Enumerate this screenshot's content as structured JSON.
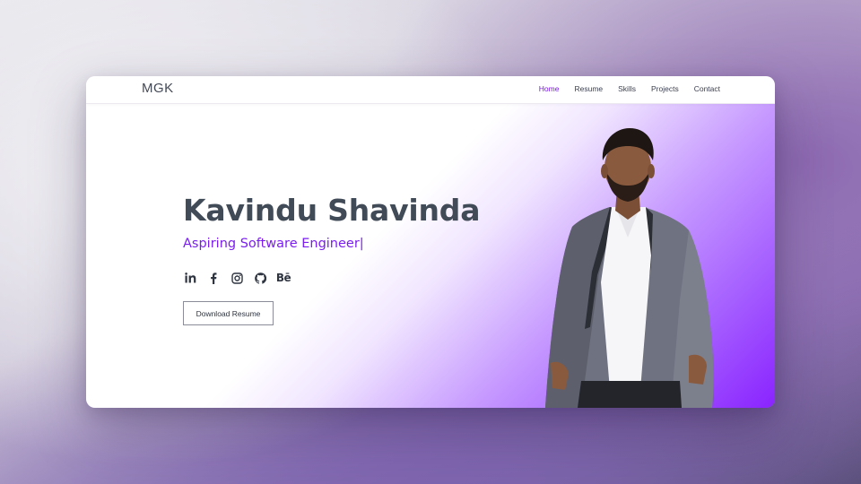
{
  "nav": {
    "brand": "MGK",
    "links": [
      {
        "label": "Home",
        "active": true
      },
      {
        "label": "Resume",
        "active": false
      },
      {
        "label": "Skills",
        "active": false
      },
      {
        "label": "Projects",
        "active": false
      },
      {
        "label": "Contact",
        "active": false
      }
    ]
  },
  "hero": {
    "name": "Kavindu Shavinda",
    "role": "Aspiring Software Engineer|",
    "download_label": "Download Resume",
    "socials": [
      {
        "icon": "linkedin-icon",
        "text": "in"
      },
      {
        "icon": "facebook-icon",
        "text": "f"
      },
      {
        "icon": "instagram-icon",
        "text": ""
      },
      {
        "icon": "github-icon",
        "text": ""
      },
      {
        "icon": "behance-icon",
        "text": "Bē"
      }
    ]
  },
  "colors": {
    "accent": "#7a17e6",
    "text": "#414a57",
    "gradient_end": "#8a23ff"
  }
}
